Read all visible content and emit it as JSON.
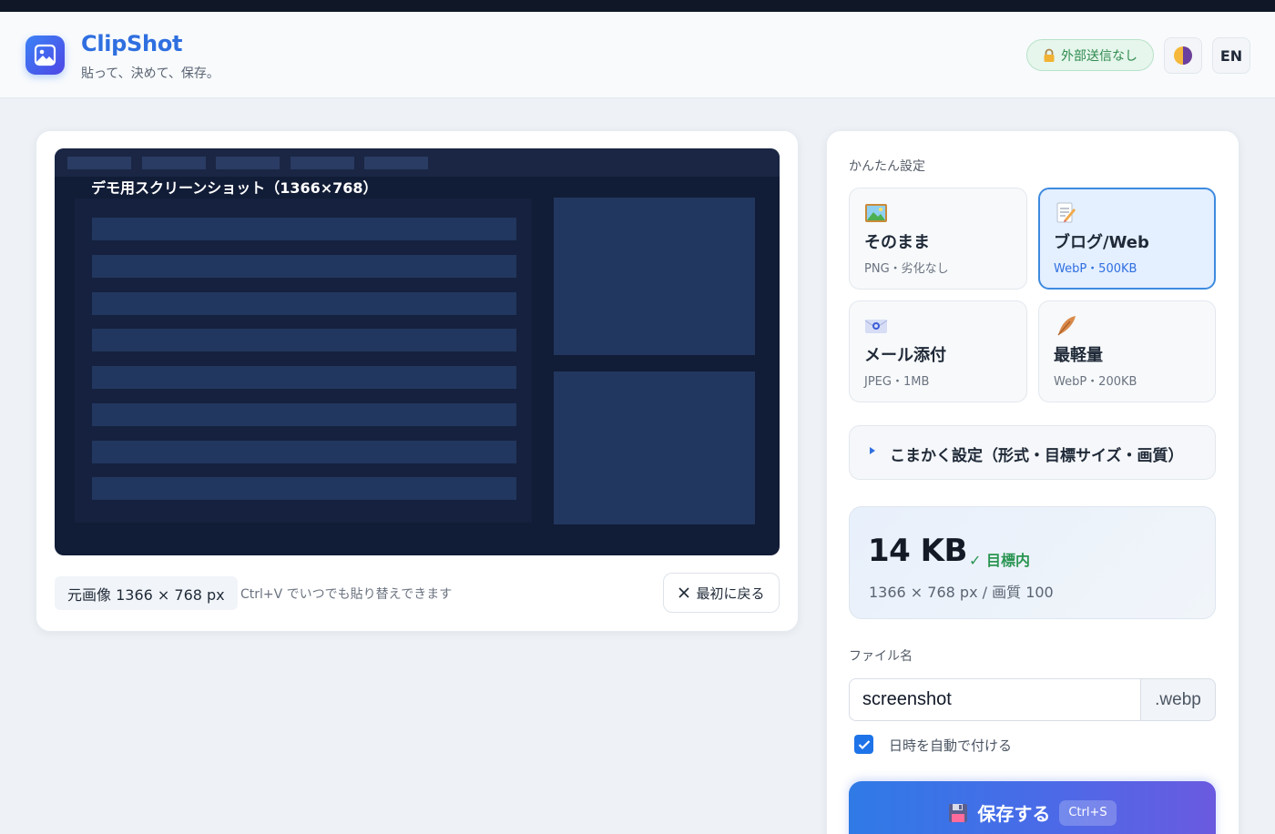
{
  "header": {
    "app_name": "ClipShot",
    "tagline": "貼って、決めて、保存。",
    "privacy_badge": "外部送信なし",
    "lang_button": "EN",
    "icons": {
      "logo": "image-icon",
      "privacy": "lock-icon",
      "theme": "theme-toggle-icon"
    }
  },
  "preview": {
    "image_caption": "デモ用スクリーンショット（1366×768）",
    "dimension_tag": "元画像 1366 × 768 px",
    "paste_hint": "Ctrl+V でいつでも貼り替えできます",
    "reset_label": "最初に戻る"
  },
  "settings": {
    "quick_label": "かんたん設定",
    "presets": [
      {
        "icon": "picture-icon",
        "name": "そのまま",
        "desc": "PNG・劣化なし",
        "active": false
      },
      {
        "icon": "memo-icon",
        "name": "ブログ/Web",
        "desc": "WebP・500KB",
        "active": true
      },
      {
        "icon": "email-icon",
        "name": "メール添付",
        "desc": "JPEG・1MB",
        "active": false
      },
      {
        "icon": "feather-icon",
        "name": "最軽量",
        "desc": "WebP・200KB",
        "active": false
      }
    ],
    "advanced_label": "こまかく設定（形式・目標サイズ・画質）",
    "result": {
      "size": "14 KB",
      "status": "✓ 目標内",
      "detail": "1366 × 768 px / 画質 100"
    },
    "filename_label": "ファイル名",
    "filename_value": "screenshot",
    "extension": ".webp",
    "timestamp_option": "日時を自動で付ける",
    "timestamp_checked": true,
    "save_label": "保存する",
    "save_shortcut": "Ctrl+S"
  },
  "colors": {
    "accent": "#2f6fe0",
    "success": "#2a9552",
    "save_gradient_start": "#2f7ae6",
    "save_gradient_end": "#6a5ae0"
  }
}
